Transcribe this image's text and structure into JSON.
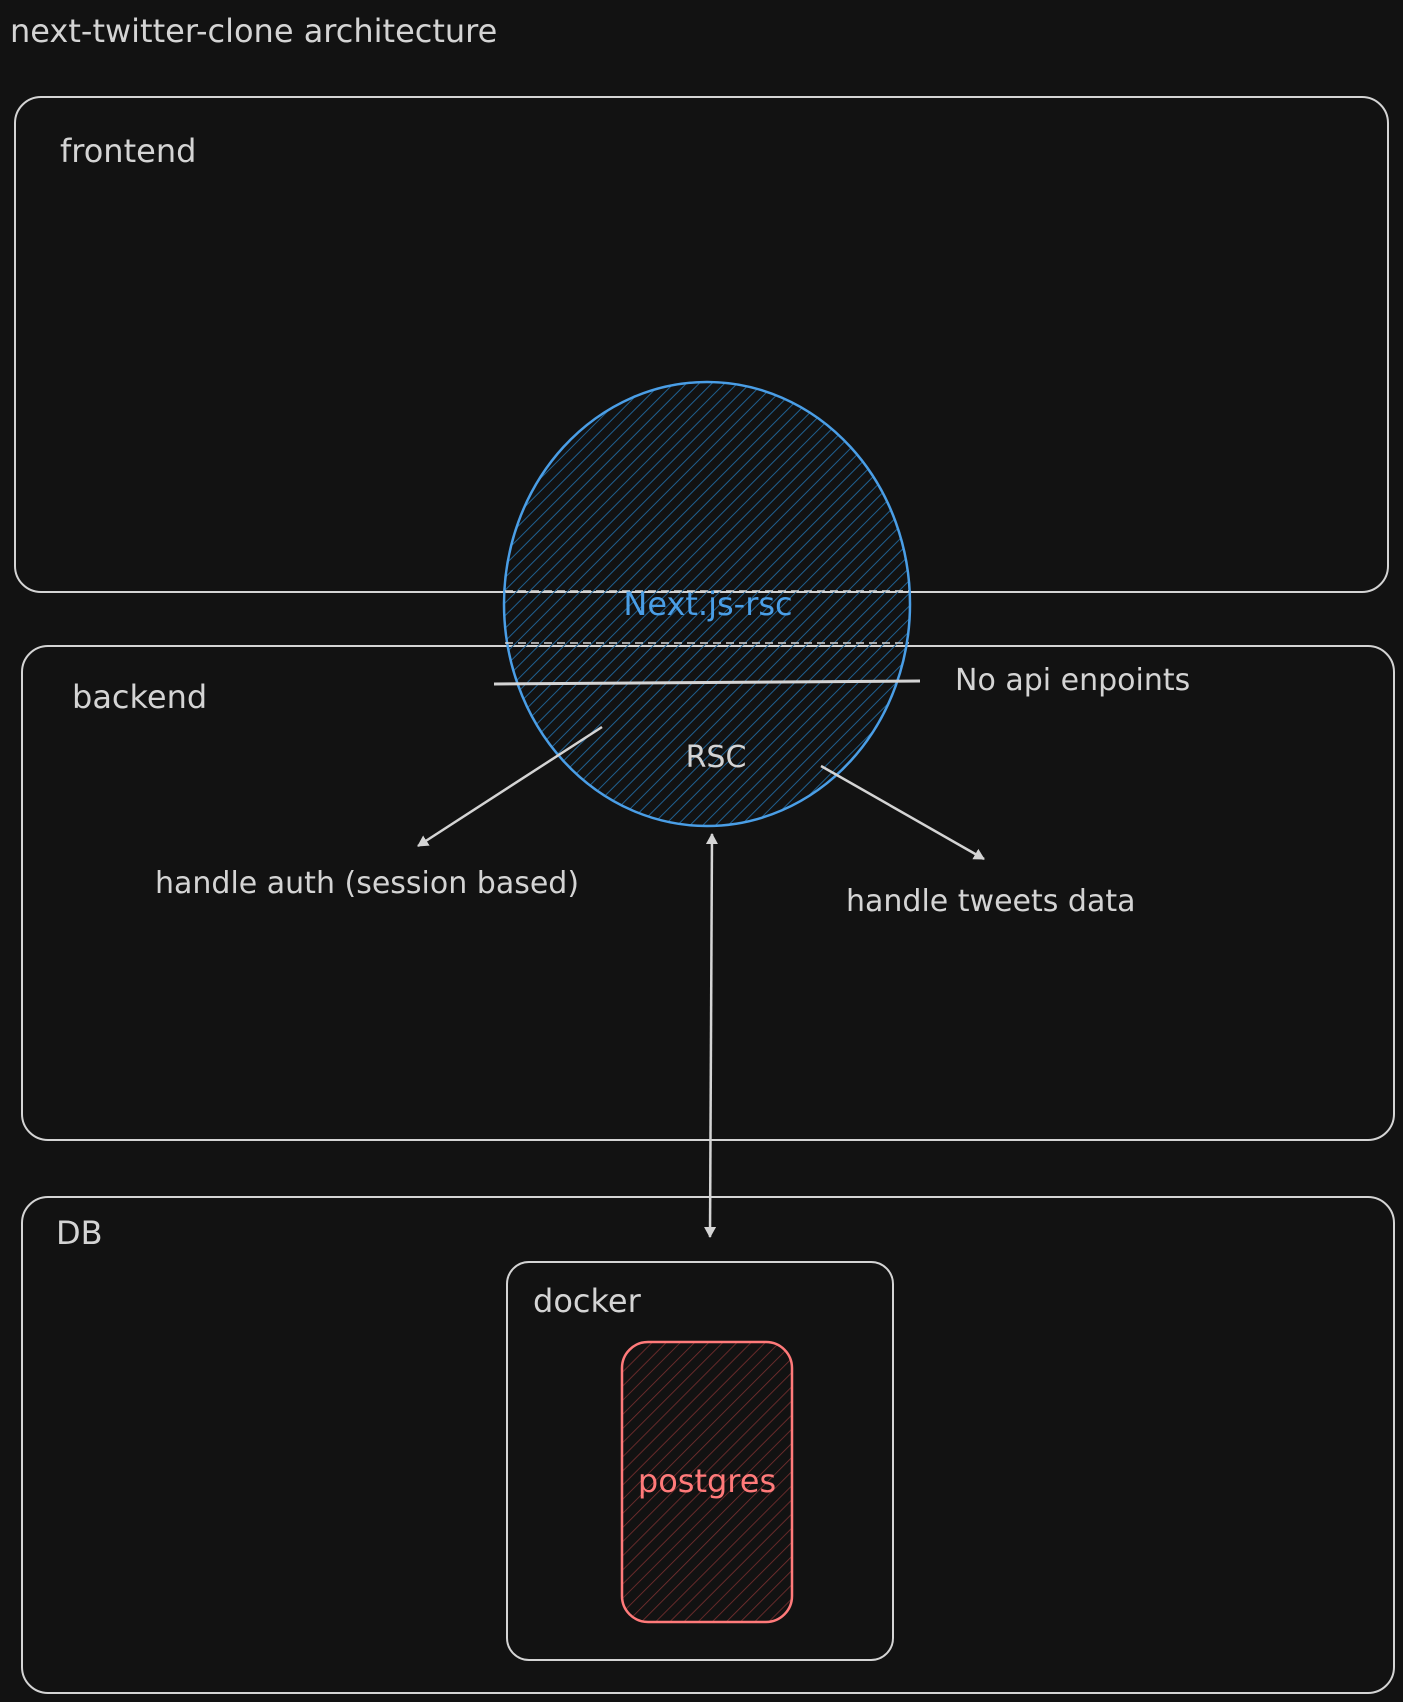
{
  "title": "next-twitter-clone architecture",
  "sections": {
    "frontend": "frontend",
    "backend": "backend",
    "db": "DB"
  },
  "nodes": {
    "nextjs": "Next.js-rsc",
    "rsc": "RSC",
    "docker": "docker",
    "postgres": "postgres"
  },
  "annotations": {
    "no_api": "No api enpoints",
    "auth": "handle auth (session based)",
    "tweets": "handle tweets data"
  },
  "colors": {
    "background": "#121212",
    "stroke": "#d4d4d4",
    "blue": "#4a9ee6",
    "red": "#ff7a7a"
  }
}
